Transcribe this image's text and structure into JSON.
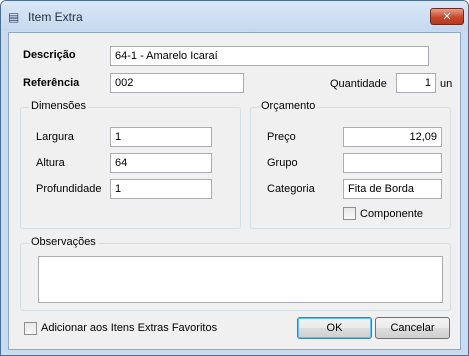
{
  "window": {
    "title": "Item Extra",
    "app_icon": "document-icon",
    "close_icon": "close-icon"
  },
  "form": {
    "descricao_label": "Descrição",
    "descricao_value": "64-1 - Amarelo Icaraí",
    "referencia_label": "Referência",
    "referencia_value": "002",
    "quantidade_label": "Quantidade",
    "quantidade_value": "1",
    "quantidade_unit": "un"
  },
  "dimensoes": {
    "title": "Dimensões",
    "largura_label": "Largura",
    "largura_value": "1",
    "altura_label": "Altura",
    "altura_value": "64",
    "profundidade_label": "Profundidade",
    "profundidade_value": "1"
  },
  "orcamento": {
    "title": "Orçamento",
    "preco_label": "Preço",
    "preco_value": "12,09",
    "grupo_label": "Grupo",
    "grupo_value": "",
    "categoria_label": "Categoria",
    "categoria_value": "Fita de Borda",
    "componente_label": "Componente",
    "componente_checked": false
  },
  "observacoes": {
    "title": "Observações",
    "value": ""
  },
  "footer": {
    "favoritos_label": "Adicionar aos Itens Extras Favoritos",
    "favoritos_checked": false,
    "ok_label": "OK",
    "cancel_label": "Cancelar"
  },
  "colors": {
    "frame": "#c9dcef",
    "client": "#f0f0f0",
    "close_button": "#c9472b"
  }
}
